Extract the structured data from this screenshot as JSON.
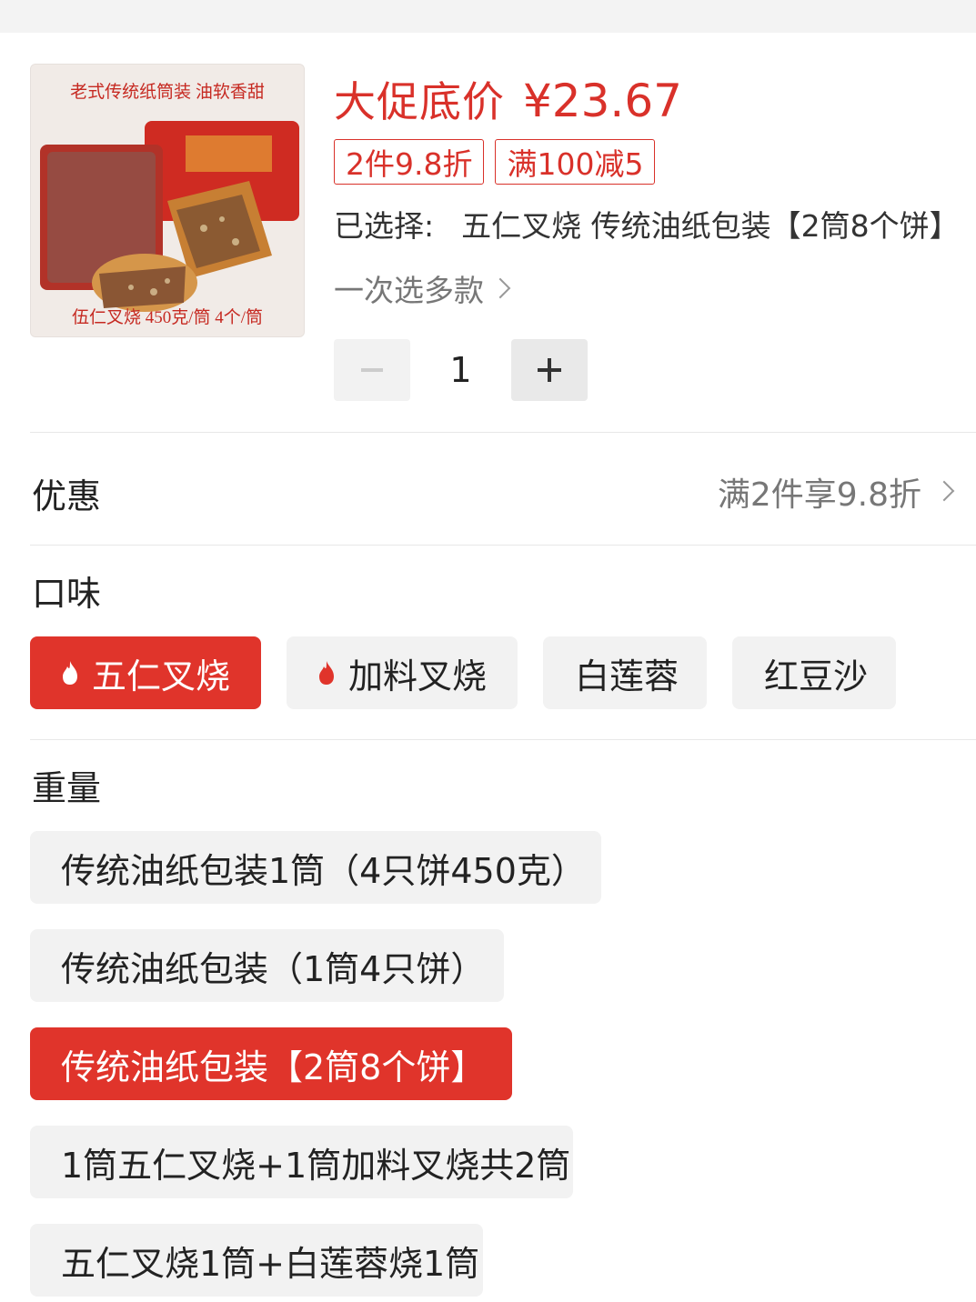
{
  "product": {
    "image_alt": "老式传统纸筒装 油软香甜 伍仁叉烧 450克/筒 4个/筒",
    "image_caption_top": "老式传统纸筒装  油软香甜",
    "image_caption_bottom": "伍仁叉烧  450克/筒  4个/筒",
    "price_label": "大促底价",
    "price_value": "¥23.67",
    "promo_tags": [
      "2件9.8折",
      "满100减5"
    ],
    "selected_label": "已选择:",
    "selected_value": "五仁叉烧 传统油纸包装【2筒8个饼】",
    "multi_select_label": "一次选多款",
    "quantity": "1"
  },
  "discount": {
    "title": "优惠",
    "value": "满2件享9.8折"
  },
  "flavor": {
    "title": "口味",
    "options": [
      {
        "label": "五仁叉烧",
        "selected": true,
        "hot": true
      },
      {
        "label": "加料叉烧",
        "selected": false,
        "hot": true
      },
      {
        "label": "白莲蓉",
        "selected": false,
        "hot": false
      },
      {
        "label": "红豆沙",
        "selected": false,
        "hot": false
      }
    ]
  },
  "weight": {
    "title": "重量",
    "options": [
      {
        "label": "传统油纸包装1筒（4只饼450克）",
        "selected": false
      },
      {
        "label": "传统油纸包装（1筒4只饼）",
        "selected": false
      },
      {
        "label": "传统油纸包装【2筒8个饼】",
        "selected": true
      },
      {
        "label": "1筒五仁叉烧+1筒加料叉烧共2筒",
        "selected": false
      },
      {
        "label": "五仁叉烧1筒+白莲蓉烧1筒",
        "selected": false
      }
    ]
  },
  "colors": {
    "accent": "#e0342b",
    "price": "#d9312a",
    "chip_bg": "#f2f2f2"
  }
}
